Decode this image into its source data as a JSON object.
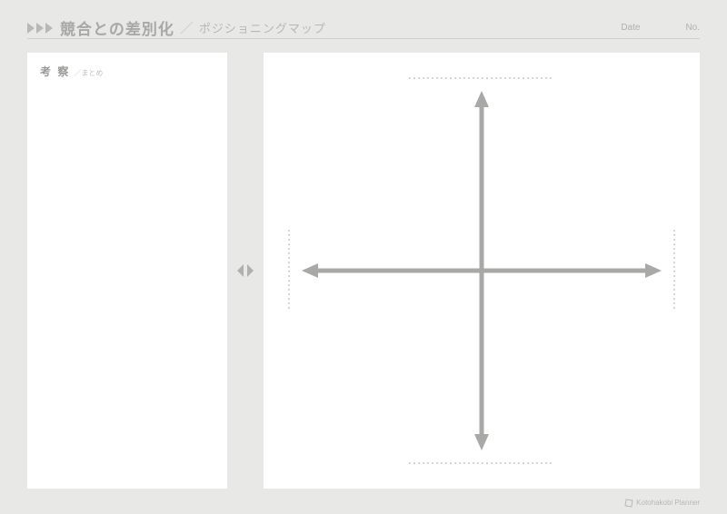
{
  "header": {
    "title_main": "競合との差別化",
    "title_sub": "ポジショニングマップ",
    "date_label": "Date",
    "no_label": "No."
  },
  "left_panel": {
    "title": "考 察",
    "subtitle": "／まとめ"
  },
  "footer": {
    "brand": "Kotohakobi Planner"
  }
}
